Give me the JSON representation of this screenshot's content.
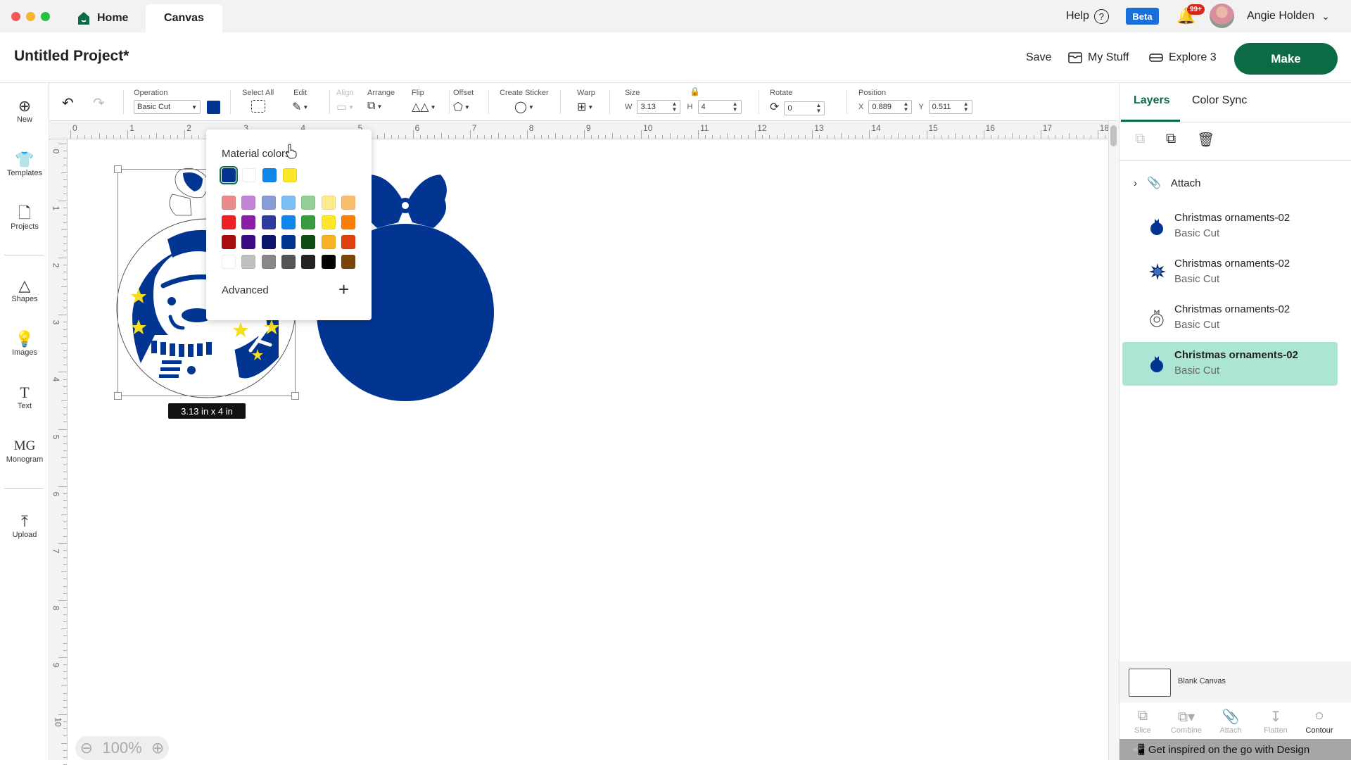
{
  "window": {
    "tabs": [
      {
        "label": "Home",
        "icon": "home-icon"
      },
      {
        "label": "Canvas",
        "active": true
      }
    ],
    "help_label": "Help",
    "beta_label": "Beta",
    "notification_count": "99+",
    "user_name": "Angie Holden"
  },
  "header": {
    "project_title": "Untitled Project*",
    "save_label": "Save",
    "my_stuff_label": "My Stuff",
    "machine_label": "Explore 3",
    "make_label": "Make"
  },
  "toolbar": {
    "operation_label": "Operation",
    "operation_value": "Basic Cut",
    "operation_color": "#023592",
    "select_all_label": "Select All",
    "edit_label": "Edit",
    "align_label": "Align",
    "arrange_label": "Arrange",
    "flip_label": "Flip",
    "offset_label": "Offset",
    "create_sticker_label": "Create Sticker",
    "warp_label": "Warp",
    "size_label": "Size",
    "w_label": "W",
    "w_value": "3.13",
    "h_label": "H",
    "h_value": "4",
    "rotate_label": "Rotate",
    "rotate_value": "0",
    "position_label": "Position",
    "x_label": "X",
    "x_value": "0.889",
    "y_label": "Y",
    "y_value": "0.511"
  },
  "sidebar": {
    "items": [
      {
        "label": "New",
        "icon": "plus-circle-icon"
      },
      {
        "label": "Templates",
        "icon": "shirt-icon"
      },
      {
        "label": "Projects",
        "icon": "projects-icon"
      },
      {
        "label": "Shapes",
        "icon": "shapes-icon"
      },
      {
        "label": "Images",
        "icon": "lightbulb-icon"
      },
      {
        "label": "Text",
        "icon": "text-icon"
      },
      {
        "label": "Monogram",
        "icon": "monogram-icon"
      },
      {
        "label": "Upload",
        "icon": "upload-icon"
      }
    ]
  },
  "rulers": {
    "horizontal": [
      "0",
      "1",
      "2",
      "3",
      "4",
      "5",
      "6",
      "7",
      "8",
      "9",
      "10",
      "11",
      "12",
      "13",
      "14",
      "15",
      "16",
      "17",
      "18"
    ],
    "vertical": [
      "0",
      "1",
      "2",
      "3",
      "4",
      "5",
      "6",
      "7",
      "8",
      "9",
      "10"
    ]
  },
  "canvas": {
    "selection_dimensions": "3.13  in x 4  in",
    "zoom_level": "100%",
    "ornament_color": "#023592",
    "star_color": "#f5dd1f"
  },
  "color_popup": {
    "title": "Material colors",
    "material_colors": [
      "#023592",
      "#ffffff",
      "#0f86ea",
      "#fde72a"
    ],
    "selected_index": 0,
    "palette": [
      [
        "#ea8a8a",
        "#c583d6",
        "#8a9bd6",
        "#7dbef5",
        "#94cf98",
        "#fbeb8e",
        "#fcbe6e"
      ],
      [
        "#ed2024",
        "#8a1ea8",
        "#2d3a9e",
        "#0f86ea",
        "#3a9c3e",
        "#fde72a",
        "#fd7e07"
      ],
      [
        "#a90c0f",
        "#3a0b85",
        "#0c146b",
        "#023592",
        "#0f4d14",
        "#f7b225",
        "#e0410c"
      ],
      [
        "#ffffff",
        "#c0c0c0",
        "#888888",
        "#555555",
        "#232323",
        "#000000",
        "#7a4508"
      ]
    ],
    "advanced_label": "Advanced"
  },
  "right_panel": {
    "tabs": [
      {
        "label": "Layers",
        "active": true
      },
      {
        "label": "Color Sync"
      }
    ],
    "group_label": "Attach",
    "layers": [
      {
        "name": "Christmas ornaments-02",
        "operation": "Basic Cut",
        "thumb": "ornament-solid"
      },
      {
        "name": "Christmas ornaments-02",
        "operation": "Basic Cut",
        "thumb": "snowflake"
      },
      {
        "name": "Christmas ornaments-02",
        "operation": "Basic Cut",
        "thumb": "snowman-outline"
      },
      {
        "name": "Christmas ornaments-02",
        "operation": "Basic Cut",
        "thumb": "ornament-solid",
        "selected": true
      }
    ],
    "blank_canvas_label": "Blank Canvas",
    "actions": [
      {
        "label": "Slice",
        "enabled": false
      },
      {
        "label": "Combine",
        "enabled": false
      },
      {
        "label": "Attach",
        "enabled": false
      },
      {
        "label": "Flatten",
        "enabled": false
      },
      {
        "label": "Contour",
        "enabled": true
      }
    ],
    "promo_text": "Get inspired on the go with Design"
  }
}
